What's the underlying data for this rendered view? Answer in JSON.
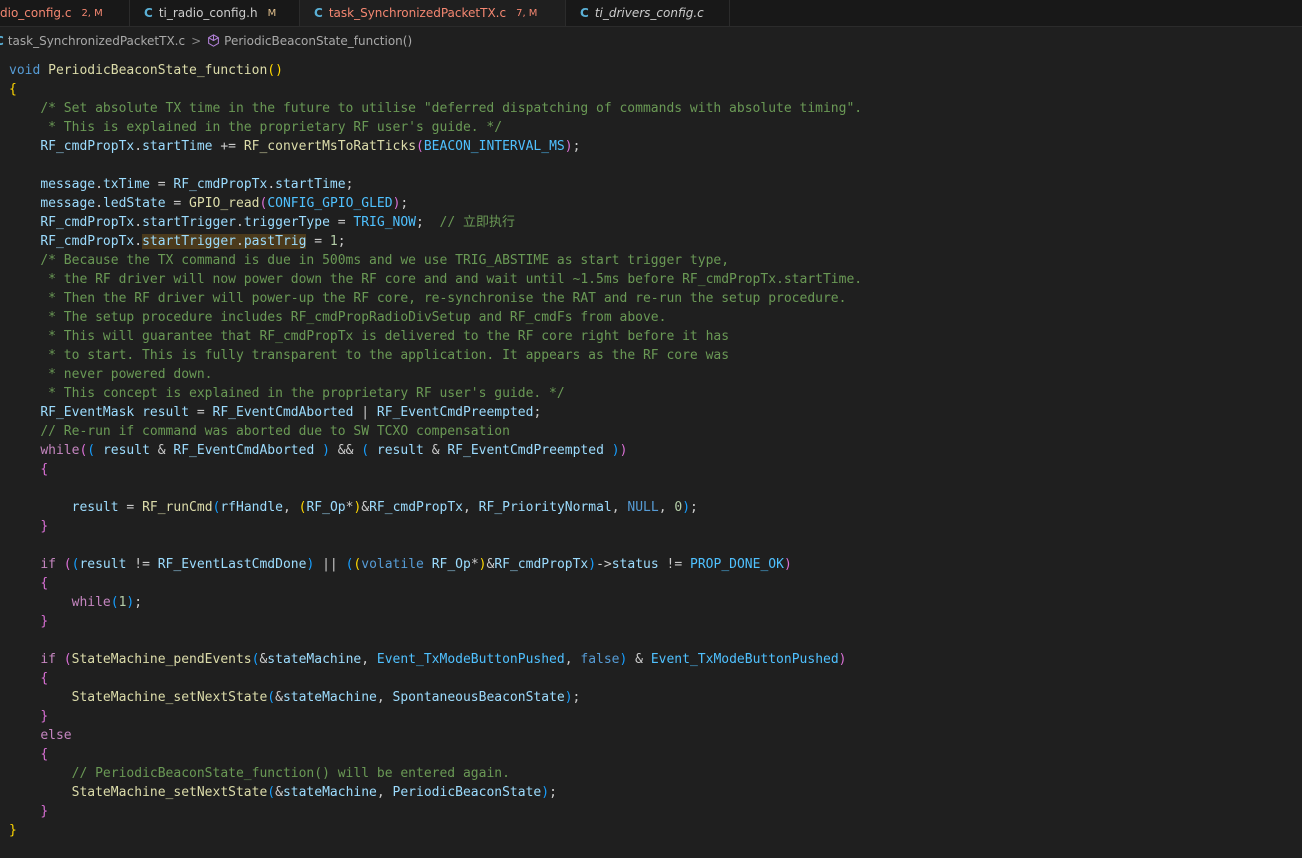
{
  "tabs": [
    {
      "lang": "",
      "name": "dio_config.c",
      "status": "2, M",
      "name_color": "#f48771",
      "status_color": "#f48771"
    },
    {
      "lang": "C",
      "name": "ti_radio_config.h",
      "status": "M",
      "name_color": "#cccccc",
      "status_color": "#e2c08d"
    },
    {
      "lang": "C",
      "name": "task_SynchronizedPacketTX.c",
      "status": "7, M",
      "name_color": "#f48771",
      "status_color": "#f48771",
      "modified": true
    },
    {
      "lang": "C",
      "name": "ti_drivers_config.c",
      "status": "",
      "name_color": "#cccccc",
      "status_color": "#cccccc"
    }
  ],
  "breadcrumb": {
    "file_icon": "C",
    "file": "task_SynchronizedPacketTX.c",
    "separator": ">",
    "symbol": "PeriodicBeaconState_function()"
  },
  "code_lines": [
    [
      {
        "t": "void",
        "c": "kw"
      },
      {
        "t": " "
      },
      {
        "t": "PeriodicBeaconState_function",
        "c": "fn"
      },
      {
        "t": "()",
        "c": "br1"
      }
    ],
    [
      {
        "t": "{",
        "c": "br1"
      }
    ],
    [
      {
        "t": "    "
      },
      {
        "t": "/* Set absolute TX time in the future to utilise \"deferred dispatching of commands with absolute timing\".",
        "c": "cm"
      }
    ],
    [
      {
        "t": "     "
      },
      {
        "t": "* This is explained in the proprietary RF user's guide. */",
        "c": "cm"
      }
    ],
    [
      {
        "t": "    "
      },
      {
        "t": "RF_cmdPropTx",
        "c": "var"
      },
      {
        "t": "."
      },
      {
        "t": "startTime",
        "c": "var"
      },
      {
        "t": " += "
      },
      {
        "t": "RF_convertMsToRatTicks",
        "c": "fn"
      },
      {
        "t": "(",
        "c": "br2"
      },
      {
        "t": "BEACON_INTERVAL_MS",
        "c": "mac"
      },
      {
        "t": ")",
        "c": "br2"
      },
      {
        "t": ";"
      }
    ],
    [],
    [
      {
        "t": "    "
      },
      {
        "t": "message",
        "c": "var"
      },
      {
        "t": "."
      },
      {
        "t": "txTime",
        "c": "var"
      },
      {
        "t": " = "
      },
      {
        "t": "RF_cmdPropTx",
        "c": "var"
      },
      {
        "t": "."
      },
      {
        "t": "startTime",
        "c": "var"
      },
      {
        "t": ";"
      }
    ],
    [
      {
        "t": "    "
      },
      {
        "t": "message",
        "c": "var"
      },
      {
        "t": "."
      },
      {
        "t": "ledState",
        "c": "var"
      },
      {
        "t": " = "
      },
      {
        "t": "GPIO_read",
        "c": "fn"
      },
      {
        "t": "(",
        "c": "br2"
      },
      {
        "t": "CONFIG_GPIO_GLED",
        "c": "mac"
      },
      {
        "t": ")",
        "c": "br2"
      },
      {
        "t": ";"
      }
    ],
    [
      {
        "t": "    "
      },
      {
        "t": "RF_cmdPropTx",
        "c": "var"
      },
      {
        "t": "."
      },
      {
        "t": "startTrigger",
        "c": "var"
      },
      {
        "t": "."
      },
      {
        "t": "triggerType",
        "c": "var"
      },
      {
        "t": " = "
      },
      {
        "t": "TRIG_NOW",
        "c": "mac"
      },
      {
        "t": ";  "
      },
      {
        "t": "// 立即执行",
        "c": "cm"
      }
    ],
    [
      {
        "t": "    "
      },
      {
        "t": "RF_cmdPropTx",
        "c": "var"
      },
      {
        "t": "."
      },
      {
        "t": "startTrigger",
        "c": "var hl"
      },
      {
        "t": ".",
        "c": "hl"
      },
      {
        "t": "pastTrig",
        "c": "var hl"
      },
      {
        "t": " = "
      },
      {
        "t": "1",
        "c": "num"
      },
      {
        "t": ";"
      }
    ],
    [
      {
        "t": "    "
      },
      {
        "t": "/* Because the TX command is due in 500ms and we use TRIG_ABSTIME as start trigger type,",
        "c": "cm"
      }
    ],
    [
      {
        "t": "     "
      },
      {
        "t": "* the RF driver will now power down the RF core and and wait until ~1.5ms before RF_cmdPropTx.startTime.",
        "c": "cm"
      }
    ],
    [
      {
        "t": "     "
      },
      {
        "t": "* Then the RF driver will power-up the RF core, re-synchronise the RAT and re-run the setup procedure.",
        "c": "cm"
      }
    ],
    [
      {
        "t": "     "
      },
      {
        "t": "* The setup procedure includes RF_cmdPropRadioDivSetup and RF_cmdFs from above.",
        "c": "cm"
      }
    ],
    [
      {
        "t": "     "
      },
      {
        "t": "* This will guarantee that RF_cmdPropTx is delivered to the RF core right before it has",
        "c": "cm"
      }
    ],
    [
      {
        "t": "     "
      },
      {
        "t": "* to start. This is fully transparent to the application. It appears as the RF core was",
        "c": "cm"
      }
    ],
    [
      {
        "t": "     "
      },
      {
        "t": "* never powered down.",
        "c": "cm"
      }
    ],
    [
      {
        "t": "     "
      },
      {
        "t": "* This concept is explained in the proprietary RF user's guide. */",
        "c": "cm"
      }
    ],
    [
      {
        "t": "    "
      },
      {
        "t": "RF_EventMask",
        "c": "var"
      },
      {
        "t": " "
      },
      {
        "t": "result",
        "c": "var"
      },
      {
        "t": " = "
      },
      {
        "t": "RF_EventCmdAborted",
        "c": "var"
      },
      {
        "t": " | "
      },
      {
        "t": "RF_EventCmdPreempted",
        "c": "var"
      },
      {
        "t": ";"
      }
    ],
    [
      {
        "t": "    "
      },
      {
        "t": "// Re-run if command was aborted due to SW TCXO compensation",
        "c": "cm"
      }
    ],
    [
      {
        "t": "    "
      },
      {
        "t": "while",
        "c": "ctl"
      },
      {
        "t": "(",
        "c": "br2"
      },
      {
        "t": "(",
        "c": "br3"
      },
      {
        "t": " "
      },
      {
        "t": "result",
        "c": "var"
      },
      {
        "t": " & "
      },
      {
        "t": "RF_EventCmdAborted",
        "c": "var"
      },
      {
        "t": " "
      },
      {
        "t": ")",
        "c": "br3"
      },
      {
        "t": " && "
      },
      {
        "t": "(",
        "c": "br3"
      },
      {
        "t": " "
      },
      {
        "t": "result",
        "c": "var"
      },
      {
        "t": " & "
      },
      {
        "t": "RF_EventCmdPreempted",
        "c": "var"
      },
      {
        "t": " "
      },
      {
        "t": ")",
        "c": "br3"
      },
      {
        "t": ")",
        "c": "br2"
      }
    ],
    [
      {
        "t": "    "
      },
      {
        "t": "{",
        "c": "br2"
      }
    ],
    [],
    [
      {
        "t": "        "
      },
      {
        "t": "result",
        "c": "var"
      },
      {
        "t": " = "
      },
      {
        "t": "RF_runCmd",
        "c": "fn"
      },
      {
        "t": "(",
        "c": "br3"
      },
      {
        "t": "rfHandle",
        "c": "var"
      },
      {
        "t": ", "
      },
      {
        "t": "(",
        "c": "br1"
      },
      {
        "t": "RF_Op",
        "c": "var"
      },
      {
        "t": "*"
      },
      {
        "t": ")",
        "c": "br1"
      },
      {
        "t": "&"
      },
      {
        "t": "RF_cmdPropTx",
        "c": "var"
      },
      {
        "t": ", "
      },
      {
        "t": "RF_PriorityNormal",
        "c": "var"
      },
      {
        "t": ", "
      },
      {
        "t": "NULL",
        "c": "kw"
      },
      {
        "t": ", "
      },
      {
        "t": "0",
        "c": "num"
      },
      {
        "t": ")",
        "c": "br3"
      },
      {
        "t": ";"
      }
    ],
    [
      {
        "t": "    "
      },
      {
        "t": "}",
        "c": "br2"
      }
    ],
    [],
    [
      {
        "t": "    "
      },
      {
        "t": "if",
        "c": "ctl"
      },
      {
        "t": " "
      },
      {
        "t": "(",
        "c": "br2"
      },
      {
        "t": "(",
        "c": "br3"
      },
      {
        "t": "result",
        "c": "var"
      },
      {
        "t": " != "
      },
      {
        "t": "RF_EventLastCmdDone",
        "c": "var"
      },
      {
        "t": ")",
        "c": "br3"
      },
      {
        "t": " || "
      },
      {
        "t": "(",
        "c": "br3"
      },
      {
        "t": "(",
        "c": "br1"
      },
      {
        "t": "volatile",
        "c": "kw"
      },
      {
        "t": " "
      },
      {
        "t": "RF_Op",
        "c": "var"
      },
      {
        "t": "*"
      },
      {
        "t": ")",
        "c": "br1"
      },
      {
        "t": "&"
      },
      {
        "t": "RF_cmdPropTx",
        "c": "var"
      },
      {
        "t": ")",
        "c": "br3"
      },
      {
        "t": "->"
      },
      {
        "t": "status",
        "c": "var"
      },
      {
        "t": " != "
      },
      {
        "t": "PROP_DONE_OK",
        "c": "mac"
      },
      {
        "t": ")",
        "c": "br2"
      }
    ],
    [
      {
        "t": "    "
      },
      {
        "t": "{",
        "c": "br2"
      }
    ],
    [
      {
        "t": "        "
      },
      {
        "t": "while",
        "c": "ctl"
      },
      {
        "t": "(",
        "c": "br3"
      },
      {
        "t": "1",
        "c": "num"
      },
      {
        "t": ")",
        "c": "br3"
      },
      {
        "t": ";"
      }
    ],
    [
      {
        "t": "    "
      },
      {
        "t": "}",
        "c": "br2"
      }
    ],
    [],
    [
      {
        "t": "    "
      },
      {
        "t": "if",
        "c": "ctl"
      },
      {
        "t": " "
      },
      {
        "t": "(",
        "c": "br2"
      },
      {
        "t": "StateMachine_pendEvents",
        "c": "fn"
      },
      {
        "t": "(",
        "c": "br3"
      },
      {
        "t": "&"
      },
      {
        "t": "stateMachine",
        "c": "var"
      },
      {
        "t": ", "
      },
      {
        "t": "Event_TxModeButtonPushed",
        "c": "mac"
      },
      {
        "t": ", "
      },
      {
        "t": "false",
        "c": "kw"
      },
      {
        "t": ")",
        "c": "br3"
      },
      {
        "t": " & "
      },
      {
        "t": "Event_TxModeButtonPushed",
        "c": "mac"
      },
      {
        "t": ")",
        "c": "br2"
      }
    ],
    [
      {
        "t": "    "
      },
      {
        "t": "{",
        "c": "br2"
      }
    ],
    [
      {
        "t": "        "
      },
      {
        "t": "StateMachine_setNextState",
        "c": "fn"
      },
      {
        "t": "(",
        "c": "br3"
      },
      {
        "t": "&"
      },
      {
        "t": "stateMachine",
        "c": "var"
      },
      {
        "t": ", "
      },
      {
        "t": "SpontaneousBeaconState",
        "c": "var"
      },
      {
        "t": ")",
        "c": "br3"
      },
      {
        "t": ";"
      }
    ],
    [
      {
        "t": "    "
      },
      {
        "t": "}",
        "c": "br2"
      }
    ],
    [
      {
        "t": "    "
      },
      {
        "t": "else",
        "c": "ctl"
      }
    ],
    [
      {
        "t": "    "
      },
      {
        "t": "{",
        "c": "br2"
      }
    ],
    [
      {
        "t": "        "
      },
      {
        "t": "// PeriodicBeaconState_function() will be entered again.",
        "c": "cm"
      }
    ],
    [
      {
        "t": "        "
      },
      {
        "t": "StateMachine_setNextState",
        "c": "fn"
      },
      {
        "t": "(",
        "c": "br3"
      },
      {
        "t": "&"
      },
      {
        "t": "stateMachine",
        "c": "var"
      },
      {
        "t": ", "
      },
      {
        "t": "PeriodicBeaconState",
        "c": "var"
      },
      {
        "t": ")",
        "c": "br3"
      },
      {
        "t": ";"
      }
    ],
    [
      {
        "t": "    "
      },
      {
        "t": "}",
        "c": "br2"
      }
    ],
    [
      {
        "t": "}",
        "c": "br1"
      }
    ]
  ]
}
